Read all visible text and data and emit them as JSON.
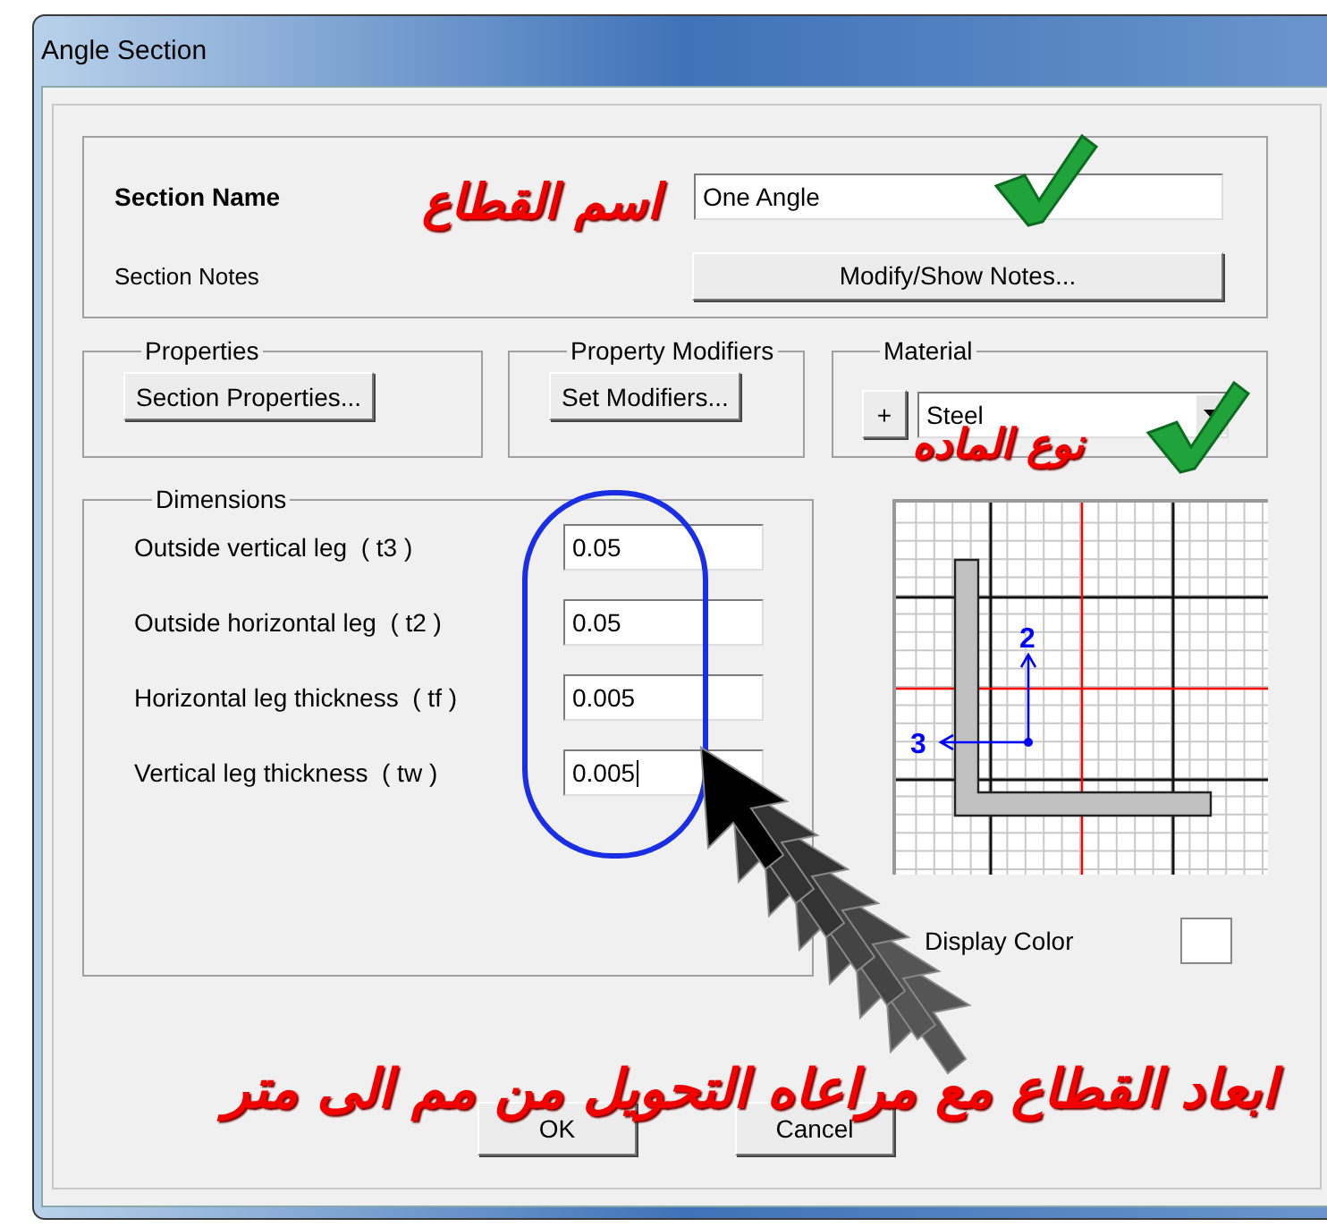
{
  "window": {
    "title": "Angle Section"
  },
  "section": {
    "name_label": "Section Name",
    "name_value": "One Angle",
    "notes_label": "Section Notes",
    "notes_button": "Modify/Show Notes..."
  },
  "groups": [
    {
      "title": "Properties",
      "button": "Section Properties..."
    },
    {
      "title": "Property Modifiers",
      "button": "Set Modifiers..."
    }
  ],
  "material": {
    "title": "Material",
    "add_button": "+",
    "value": "Steel"
  },
  "dimensions": {
    "title": "Dimensions",
    "fields": [
      {
        "label": "Outside vertical leg  ( t3 )",
        "value": "0.05",
        "focused": false
      },
      {
        "label": "Outside horizontal leg  ( t2 )",
        "value": "0.05",
        "focused": false
      },
      {
        "label": "Horizontal leg thickness  ( tf )",
        "value": "0.005",
        "focused": false
      },
      {
        "label": "Vertical leg thickness  ( tw )",
        "value": "0.005",
        "focused": true
      }
    ]
  },
  "diagram": {
    "axis_labels": [
      "2",
      "3"
    ]
  },
  "display_color": {
    "label": "Display Color",
    "color": "#ffffff"
  },
  "buttons": [
    "OK",
    "Cancel"
  ],
  "annotations": [
    {
      "kind": "label",
      "text": "اسم القطاع"
    },
    {
      "kind": "label",
      "text": "نوع الماده"
    },
    {
      "kind": "note",
      "text": "ابعاد القطاع مع مراعاه التحويل من مم الى متر"
    }
  ]
}
